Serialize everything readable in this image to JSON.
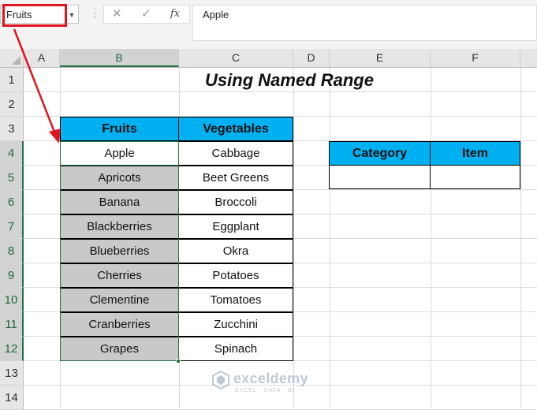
{
  "formula_bar": {
    "name_box": "Fruits",
    "cancel_glyph": "✕",
    "enter_glyph": "✓",
    "fx_label": "fx",
    "formula_value": "Apple"
  },
  "columns": [
    "A",
    "B",
    "C",
    "D",
    "E",
    "F"
  ],
  "selected_column": "B",
  "rows": [
    "1",
    "2",
    "3",
    "4",
    "5",
    "6",
    "7",
    "8",
    "9",
    "10",
    "11",
    "12",
    "13",
    "14"
  ],
  "selected_rows": [
    "4",
    "5",
    "6",
    "7",
    "8",
    "9",
    "10",
    "11",
    "12"
  ],
  "sheet": {
    "title": "Using Named Range",
    "table1": {
      "headers": [
        "Fruits",
        "Vegetables"
      ],
      "fruits": [
        "Apple",
        "Apricots",
        "Banana",
        "Blackberries",
        "Blueberries",
        "Cherries",
        "Clementine",
        "Cranberries",
        "Grapes"
      ],
      "vegetables": [
        "Cabbage",
        "Beet Greens",
        "Broccoli",
        "Eggplant",
        "Okra",
        "Potatoes",
        "Tomatoes",
        "Zucchini",
        "Spinach"
      ]
    },
    "table2": {
      "headers": [
        "Category",
        "Item"
      ],
      "row": [
        "",
        ""
      ]
    }
  },
  "watermark": {
    "name": "exceldemy",
    "tagline": "EXCEL · DATA · BI"
  },
  "colors": {
    "header_fill": "#00b0f0",
    "selection_green": "#217346",
    "selected_fill": "#c9c9c9",
    "annotation_red": "#e0141e"
  }
}
